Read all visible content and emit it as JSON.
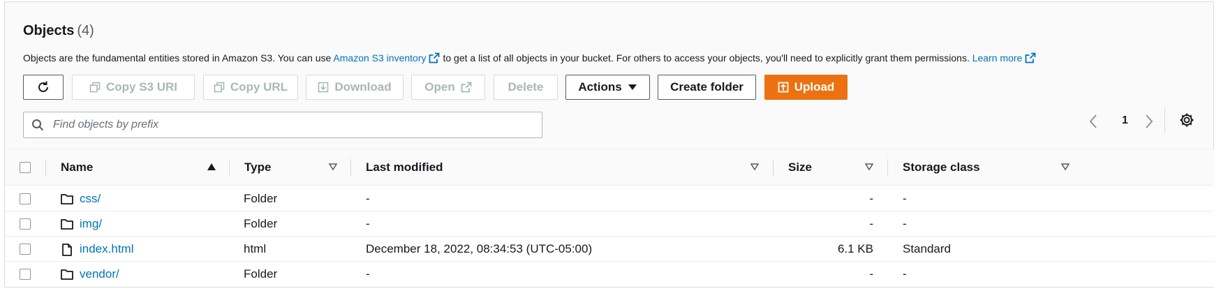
{
  "header": {
    "title": "Objects",
    "count": "(4)"
  },
  "description": {
    "part1": "Objects are the fundamental entities stored in Amazon S3. You can use",
    "inventory_link": "Amazon S3 inventory",
    "part2": "to get a list of all objects in your bucket. For others to access your objects, you'll need to explicitly grant them permissions.",
    "learn_more": "Learn more"
  },
  "toolbar": {
    "copy_s3_uri": "Copy S3 URI",
    "copy_url": "Copy URL",
    "download": "Download",
    "open": "Open",
    "delete": "Delete",
    "actions": "Actions",
    "create_folder": "Create folder",
    "upload": "Upload"
  },
  "search": {
    "placeholder": "Find objects by prefix",
    "value": ""
  },
  "pagination": {
    "current_page": "1"
  },
  "table": {
    "columns": {
      "name": "Name",
      "type": "Type",
      "last_modified": "Last modified",
      "size": "Size",
      "storage_class": "Storage class"
    },
    "rows": [
      {
        "name": "css/",
        "icon": "folder-icon",
        "type": "Folder",
        "last_modified": "-",
        "size": "-",
        "storage_class": "-"
      },
      {
        "name": "img/",
        "icon": "folder-icon",
        "type": "Folder",
        "last_modified": "-",
        "size": "-",
        "storage_class": "-"
      },
      {
        "name": "index.html",
        "icon": "file-icon",
        "type": "html",
        "last_modified": "December 18, 2022, 08:34:53 (UTC-05:00)",
        "size": "6.1 KB",
        "storage_class": "Standard"
      },
      {
        "name": "vendor/",
        "icon": "folder-icon",
        "type": "Folder",
        "last_modified": "-",
        "size": "-",
        "storage_class": "-"
      }
    ]
  },
  "colors": {
    "accent": "#ec7211",
    "link": "#0073bb",
    "disabled": "#aab7b8"
  }
}
